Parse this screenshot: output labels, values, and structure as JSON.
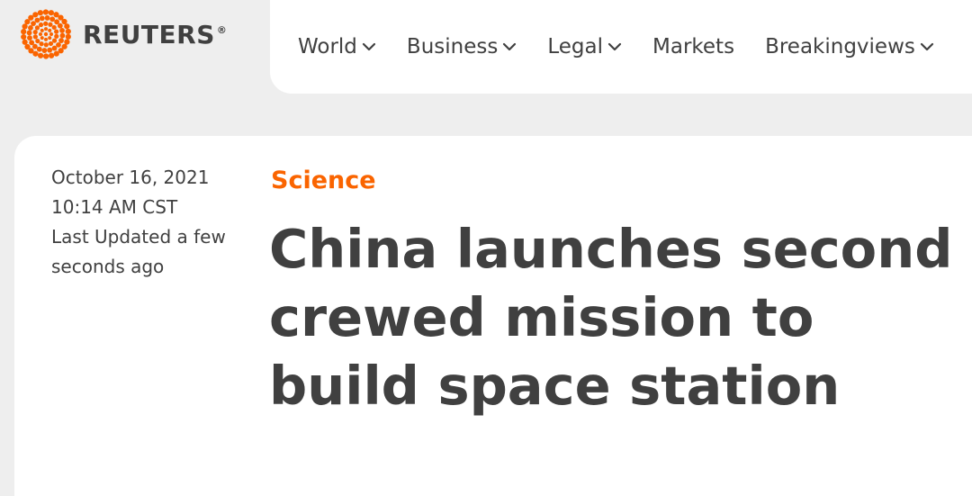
{
  "brand": {
    "name": "REUTERS",
    "registered_mark": "®",
    "logo_icon": "reuters-dot-logo",
    "accent_color": "#fa6400"
  },
  "nav": {
    "items": [
      {
        "label": "World",
        "has_dropdown": true
      },
      {
        "label": "Business",
        "has_dropdown": true
      },
      {
        "label": "Legal",
        "has_dropdown": true
      },
      {
        "label": "Markets",
        "has_dropdown": false
      },
      {
        "label": "Breakingviews",
        "has_dropdown": true
      }
    ]
  },
  "article": {
    "date": "October 16, 2021",
    "time": "10:14 AM CST",
    "updated_line1": "Last Updated a few",
    "updated_line2": "seconds ago",
    "section": "Science",
    "headline_lines": [
      "China launches second",
      "crewed mission to",
      "build space station"
    ]
  }
}
